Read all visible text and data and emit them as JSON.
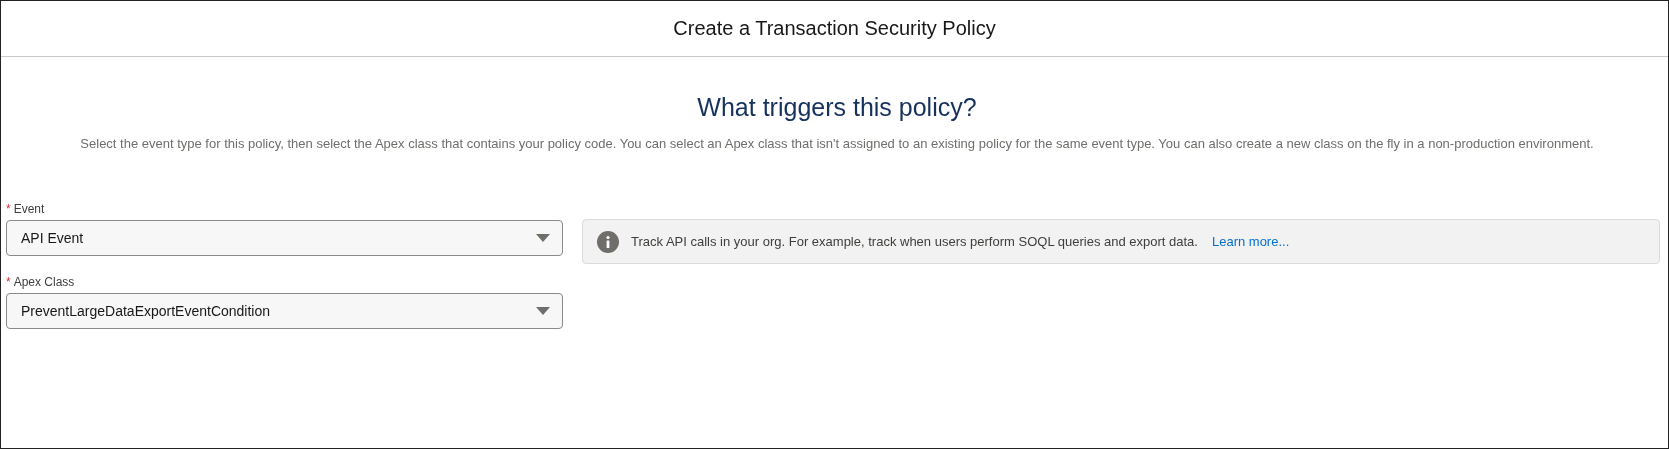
{
  "window": {
    "title": "Create a Transaction Security Policy"
  },
  "heading": "What triggers this policy?",
  "description": "Select the event type for this policy, then select the Apex class that contains your policy code. You can select an Apex class that isn't assigned to an existing policy for the same event type. You can also create a new class on the fly in a non-production environment.",
  "fields": [
    {
      "required_mark": "*",
      "label": "Event",
      "value": "API Event"
    },
    {
      "required_mark": "*",
      "label": "Apex Class",
      "value": "PreventLargeDataExportEventCondition"
    }
  ],
  "info": {
    "text": "Track API calls in your org. For example, track when users perform SOQL queries and export data.",
    "link": "Learn more..."
  }
}
